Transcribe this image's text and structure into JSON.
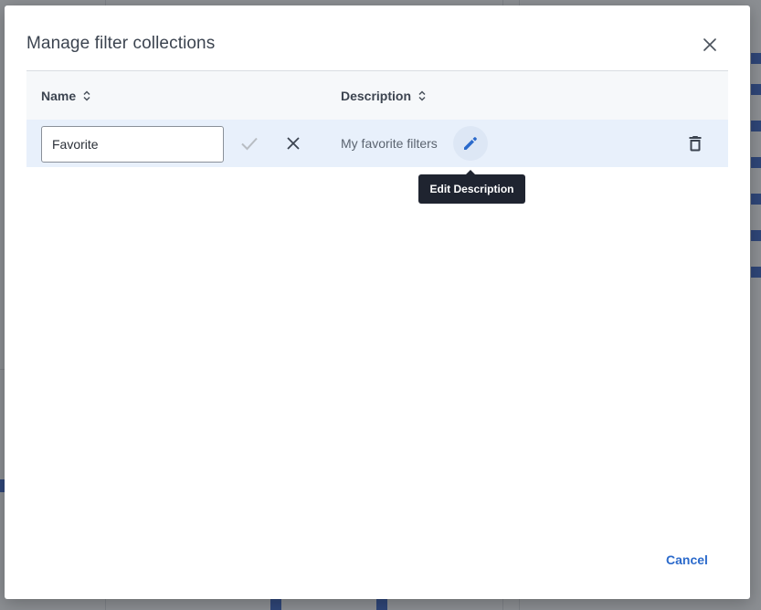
{
  "dialog": {
    "title": "Manage filter collections",
    "close_icon": "close-icon"
  },
  "table": {
    "columns": [
      {
        "label": "Name",
        "sort_icon": "sort-icon"
      },
      {
        "label": "Description",
        "sort_icon": "sort-icon"
      }
    ],
    "rows": [
      {
        "name_value": "Favorite",
        "description": "My favorite filters",
        "actions": [
          "check-icon",
          "close-icon",
          "pencil-icon",
          "trash-icon"
        ]
      }
    ]
  },
  "tooltip": {
    "text": "Edit Description"
  },
  "footer": {
    "cancel_label": "Cancel"
  },
  "colors": {
    "accent": "#2b6acb",
    "row_highlight": "#e8f0fb",
    "tooltip_bg": "#1f2430"
  }
}
